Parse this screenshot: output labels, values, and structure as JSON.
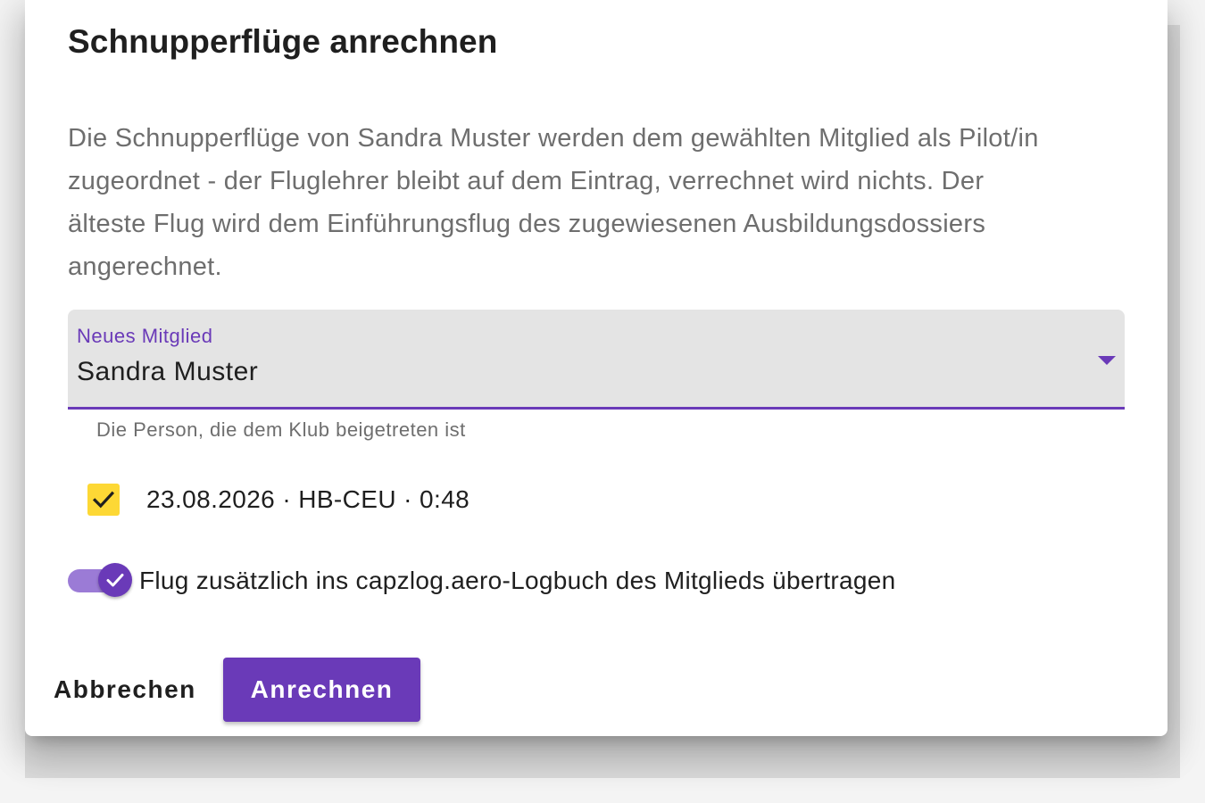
{
  "dialog": {
    "title": "Schnupperflüge anrechnen",
    "description": "Die Schnupperflüge von Sandra Muster werden dem gewählten Mitglied als Pilot/in zugeordnet - der Fluglehrer bleibt auf dem Eintrag, verrechnet wird nichts. Der älteste Flug wird dem Einführungsflug des zugewiesenen Ausbildungsdossiers angerechnet."
  },
  "member_select": {
    "label": "Neues Mitglied",
    "value": "Sandra Muster",
    "hint": "Die Person, die dem Klub beigetreten ist"
  },
  "flights": [
    {
      "label": "23.08.2026 · HB-CEU · 0:48",
      "checked": true
    }
  ],
  "logbook_toggle": {
    "label": "Flug zusätzlich ins capzlog.aero-Logbuch des Mitglieds übertragen",
    "on": true
  },
  "actions": {
    "cancel_label": "Abbrechen",
    "submit_label": "Anrechnen"
  },
  "colors": {
    "primary": "#6a3ab8",
    "checkbox": "#fdd835",
    "toggle_track": "#9b7bd6"
  }
}
